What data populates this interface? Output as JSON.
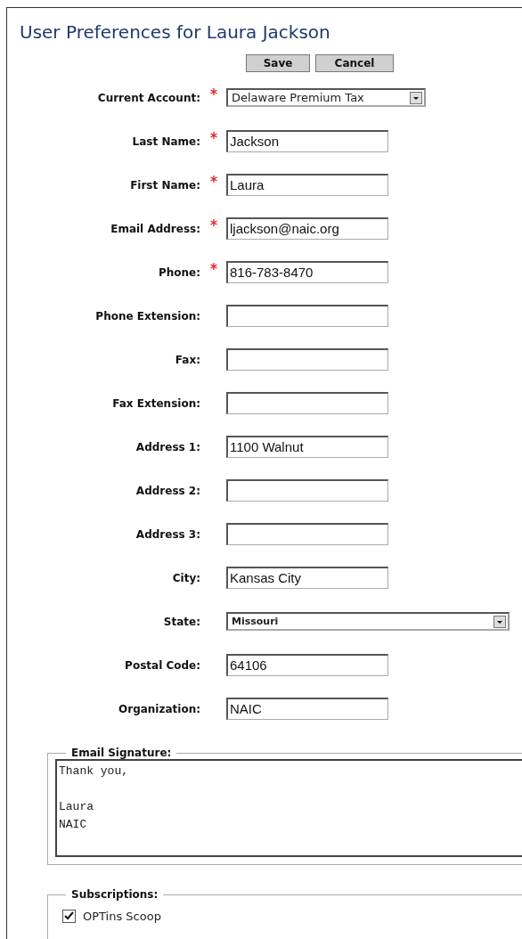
{
  "title": "User Preferences for Laura Jackson",
  "buttons": [
    "Save",
    "Cancel"
  ],
  "fields": [
    {
      "label": "Current Account:",
      "required": true,
      "kind": "select",
      "value": "Delaware Premium Tax"
    },
    {
      "label": "Last Name:",
      "required": true,
      "kind": "text",
      "value": "Jackson"
    },
    {
      "label": "First Name:",
      "required": true,
      "kind": "text",
      "value": "Laura"
    },
    {
      "label": "Email Address:",
      "required": true,
      "kind": "text",
      "value": "ljackson@naic.org"
    },
    {
      "label": "Phone:",
      "required": true,
      "kind": "text",
      "value": "816-783-8470"
    },
    {
      "label": "Phone Extension:",
      "required": false,
      "kind": "text"
    },
    {
      "label": "Fax:",
      "required": false,
      "kind": "text"
    },
    {
      "label": "Fax Extension:",
      "required": false,
      "kind": "text"
    },
    {
      "label": "Address 1:",
      "required": false,
      "kind": "text",
      "value": "1100 Walnut"
    },
    {
      "label": "Address 2:",
      "required": false,
      "kind": "text"
    },
    {
      "label": "Address 3:",
      "required": false,
      "kind": "text"
    },
    {
      "label": "City:",
      "required": false,
      "kind": "text",
      "value": "Kansas City"
    },
    {
      "label": "State:",
      "required": false,
      "kind": "wideselect",
      "value": "Missouri"
    },
    {
      "label": "Postal Code:",
      "required": false,
      "kind": "text",
      "value": "64106"
    },
    {
      "label": "Organization:",
      "required": false,
      "kind": "text",
      "value": "NAIC"
    }
  ],
  "email_signature": {
    "legend": "Email Signature:",
    "value": "Thank you,\n\nLaura\nNAIC"
  },
  "subscriptions": {
    "legend": "Subscriptions:",
    "items": [
      {
        "label": "OPTins Scoop",
        "checked": true
      }
    ]
  }
}
